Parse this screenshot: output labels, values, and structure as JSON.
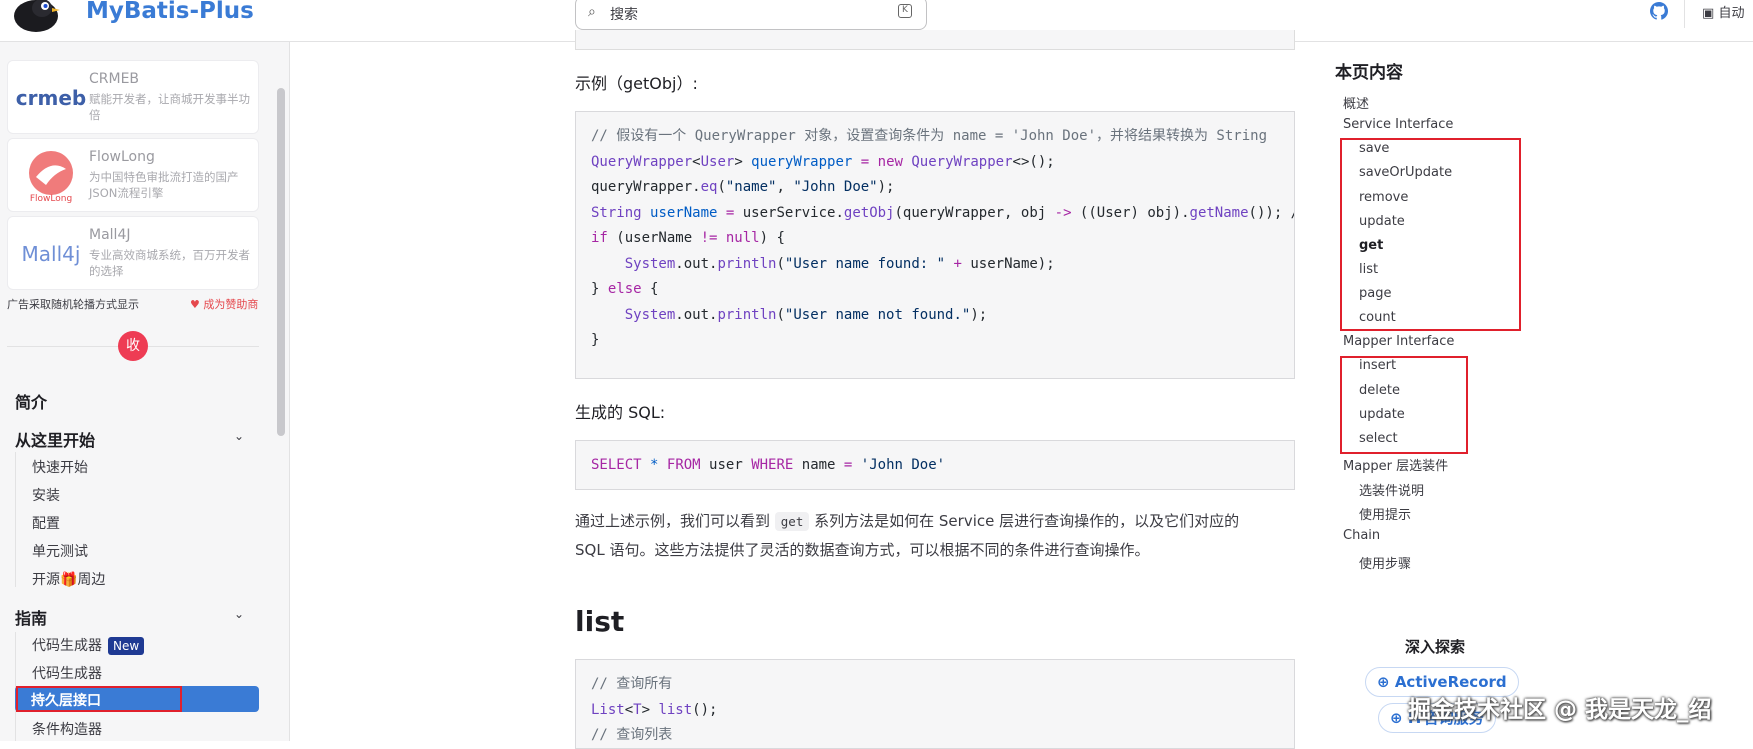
{
  "header": {
    "site_title": "MyBatis-Plus",
    "search_placeholder": "搜索",
    "appearance_label": "自动"
  },
  "sidebar": {
    "ads": [
      {
        "name": "CRMEB",
        "desc": "赋能开发者，让商城开发事半功倍",
        "logo_text": "crmeb"
      },
      {
        "name": "FlowLong",
        "desc": "为中国特色审批流打造的国产JSON流程引擎",
        "logo_text": "FlowLong"
      },
      {
        "name": "Mall4J",
        "desc": "专业高效商城系统，百万开发者的选择",
        "logo_text": "Mall4j"
      }
    ],
    "ad_note": "广告采取随机轮播方式显示",
    "sponsor_link": "成为赞助商",
    "collapse_label": "收",
    "nav": {
      "intro": "简介",
      "getting_started": {
        "title": "从这里开始",
        "items": [
          "快速开始",
          "安装",
          "配置",
          "单元测试",
          "开源🎁周边"
        ]
      },
      "guide": {
        "title": "指南",
        "items": [
          "代码生成器",
          "代码生成器",
          "持久层接口",
          "条件构造器"
        ],
        "new_badge": "New",
        "active": "持久层接口"
      }
    }
  },
  "main": {
    "example_heading": "示例（getObj）:",
    "code1": {
      "lines": [
        "// 假设有一个 QueryWrapper 对象，设置查询条件为 name = 'John Doe'，并将结果转换为 String",
        "QueryWrapper<User> queryWrapper = new QueryWrapper<>();",
        "queryWrapper.eq(\"name\", \"John Doe\");",
        "String userName = userService.getObj(queryWrapper, obj -> ((User) obj).getName()); //",
        "if (userName != null) {",
        "    System.out.println(\"User name found: \" + userName);",
        "} else {",
        "    System.out.println(\"User name not found.\");",
        "}"
      ]
    },
    "sql_heading": "生成的 SQL:",
    "sql": "SELECT * FROM user WHERE name = 'John Doe'",
    "summary_part1": "通过上述示例，我们可以看到 ",
    "summary_code": "get",
    "summary_part2": " 系列方法是如何在 Service 层进行查询操作的，以及它们对应的",
    "summary_line2": "SQL 语句。这些方法提供了灵活的数据查询方式，可以根据不同的条件进行查询操作。",
    "section_title": "list",
    "code2": {
      "lines": [
        "// 查询所有",
        "List<T> list();",
        "// 查询列表"
      ]
    }
  },
  "outline": {
    "title": "本页内容",
    "items": [
      {
        "label": "概述",
        "level": 1
      },
      {
        "label": "Service Interface",
        "level": 1
      },
      {
        "label": "save",
        "level": 2
      },
      {
        "label": "saveOrUpdate",
        "level": 2
      },
      {
        "label": "remove",
        "level": 2
      },
      {
        "label": "update",
        "level": 2
      },
      {
        "label": "get",
        "level": 2,
        "active": true
      },
      {
        "label": "list",
        "level": 2
      },
      {
        "label": "page",
        "level": 2
      },
      {
        "label": "count",
        "level": 2
      },
      {
        "label": "Mapper Interface",
        "level": 1
      },
      {
        "label": "insert",
        "level": 2
      },
      {
        "label": "delete",
        "level": 2
      },
      {
        "label": "update",
        "level": 2
      },
      {
        "label": "select",
        "level": 2
      },
      {
        "label": "Mapper 层选装件",
        "level": 1
      },
      {
        "label": "选装件说明",
        "level": 2
      },
      {
        "label": "使用提示",
        "level": 2
      },
      {
        "label": "Chain",
        "level": 1
      },
      {
        "label": "使用步骤",
        "level": 2
      }
    ],
    "deep_dive_title": "深入探索",
    "links": [
      "ActiveRecord",
      "IT咨询服务"
    ]
  },
  "watermark": "掘金技术社区 @ 我是天龙_绍",
  "colors": {
    "accent": "#3a7bd5",
    "highlight_box": "#e0202c",
    "collapse": "#ee3c54",
    "badge": "#1f3a93"
  }
}
